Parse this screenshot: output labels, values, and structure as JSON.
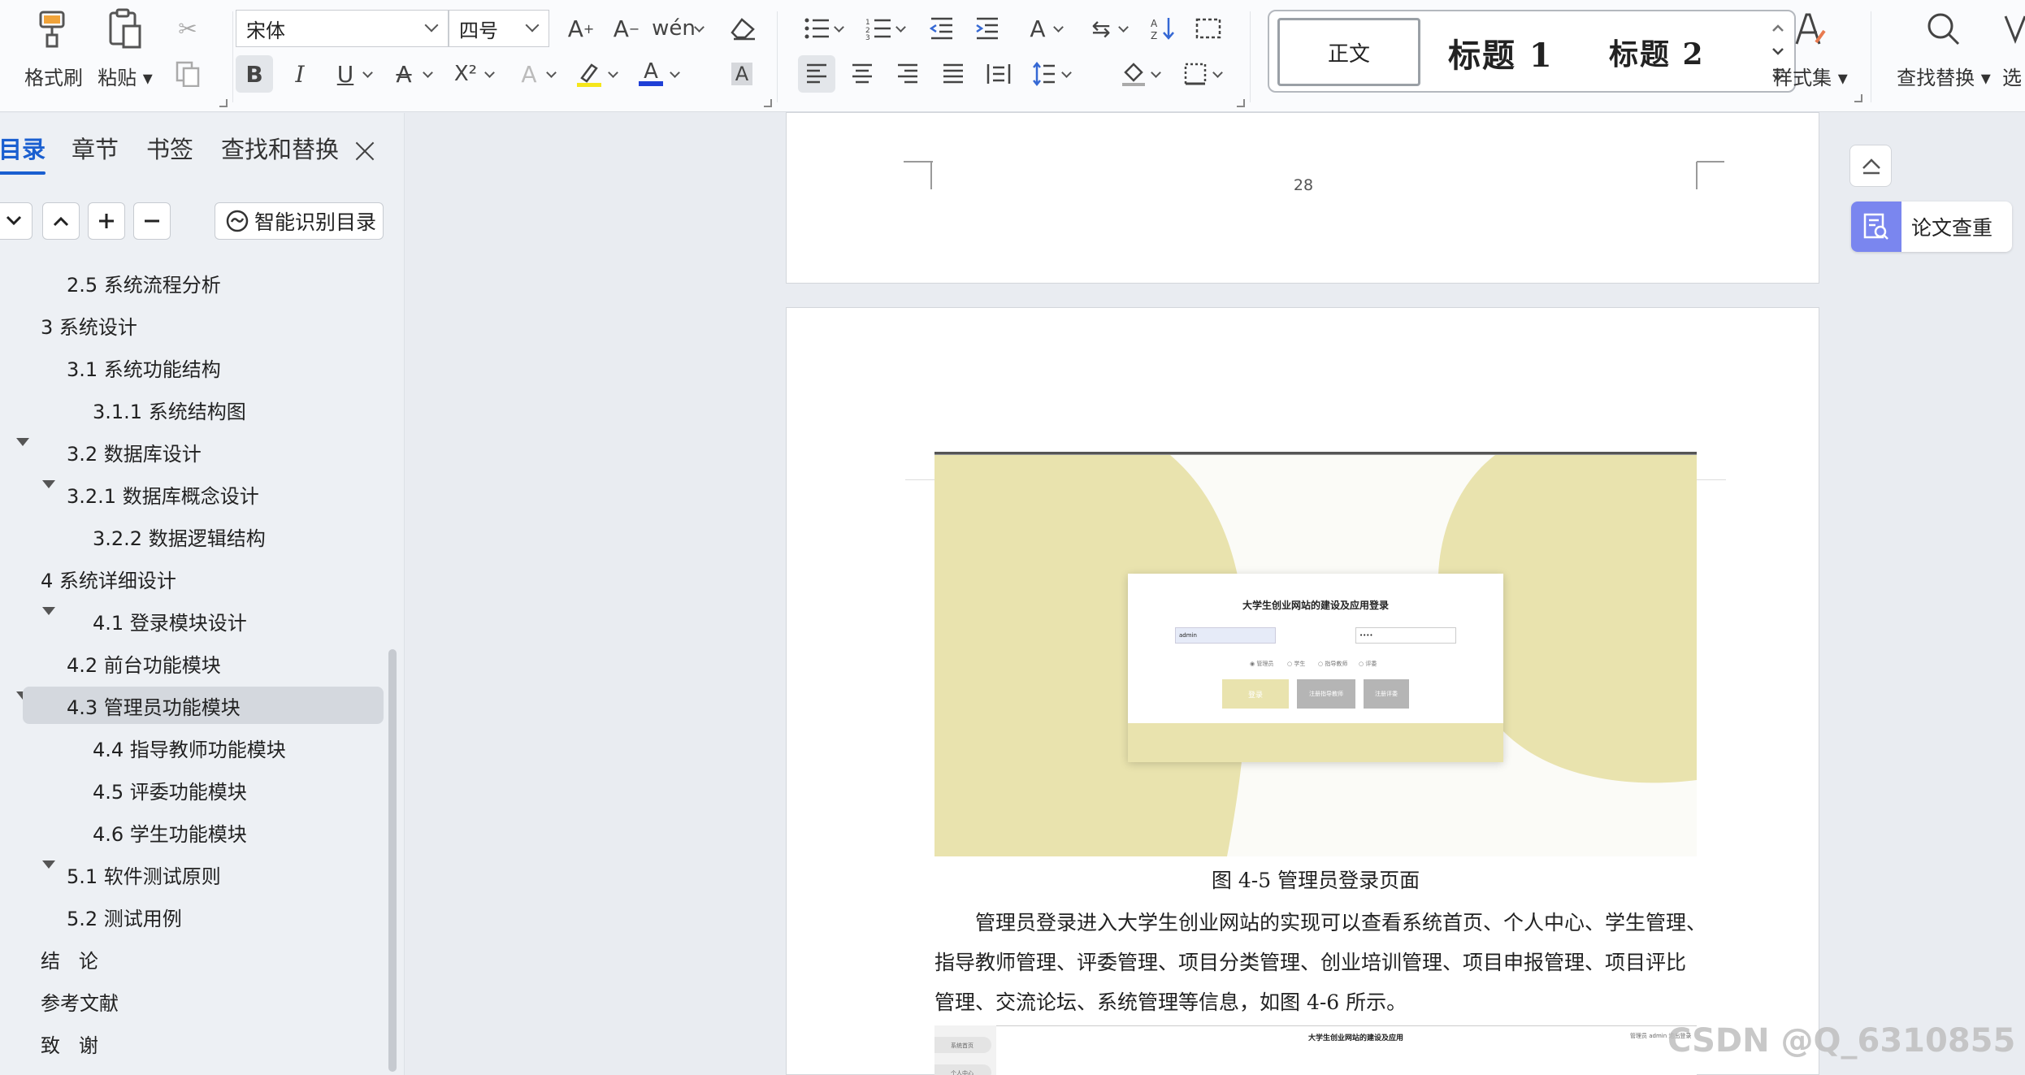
{
  "ribbon": {
    "format_painter": "格式刷",
    "paste": "粘贴",
    "font_name": "宋体",
    "font_size": "四号",
    "bold": "B",
    "italic": "I",
    "underline": "U",
    "superscript": "X²",
    "styles": {
      "normal": "正文",
      "heading1": "标题 1",
      "heading2": "标题 2"
    },
    "style_set": "样式集",
    "find_replace": "查找替换",
    "select": "选",
    "highlight_color": "#f5e61b",
    "font_color": "#1f3fd6"
  },
  "nav": {
    "tabs": [
      "目录",
      "章节",
      "书签",
      "查找和替换"
    ],
    "smart_toc": "智能识别目录",
    "items": [
      {
        "label": "2.5 系统流程分析"
      },
      {
        "label": "3 系统设计"
      },
      {
        "label": "3.1 系统功能结构"
      },
      {
        "label": "3.1.1 系统结构图"
      },
      {
        "label": "3.2 数据库设计"
      },
      {
        "label": "3.2.1  数据库概念设计"
      },
      {
        "label": "3.2.2 数据逻辑结构"
      },
      {
        "label": "4 系统详细设计"
      },
      {
        "label": "4.1 登录模块设计"
      },
      {
        "label": "4.2  前台功能模块"
      },
      {
        "label": "4.3 管理员功能模块"
      },
      {
        "label": "4.4  指导教师功能模块"
      },
      {
        "label": "4.5  评委功能模块"
      },
      {
        "label": "4.6  学生功能模块"
      },
      {
        "label": "5.1 软件测试原则"
      },
      {
        "label": "5.2 测试用例"
      },
      {
        "label": "结   论"
      },
      {
        "label": "参考文献"
      },
      {
        "label": "致   谢"
      }
    ]
  },
  "document": {
    "page_number": "28",
    "figure": {
      "login_title": "大学生创业网站的建设及应用登录",
      "username": "admin",
      "password": "••••",
      "roles": [
        "管理员",
        "学生",
        "指导教师",
        "评委"
      ],
      "login_button": "登录",
      "btn2": "注册指导教师",
      "btn3": "注册评委",
      "accent_color": "#e9e3ae"
    },
    "caption": "图 4-5 管理员登录页面",
    "para_lines": [
      "管理员登录进入大学生创业网站的实现可以查看系统首页、个人中心、学生管理、",
      "指导教师管理、评委管理、项目分类管理、创业培训管理、项目申报管理、项目评比",
      "管理、交流论坛、系统管理等信息，如图 4-6 所示。"
    ],
    "next_figure_title": "大学生创业网站的建设及应用",
    "next_figure_user": "管理员 admin  退出登录",
    "next_figure_menu": [
      "系统首页",
      "个人中心"
    ]
  },
  "side": {
    "paper_check": "论文查重"
  },
  "watermark": "CSDN @Q_6310855"
}
